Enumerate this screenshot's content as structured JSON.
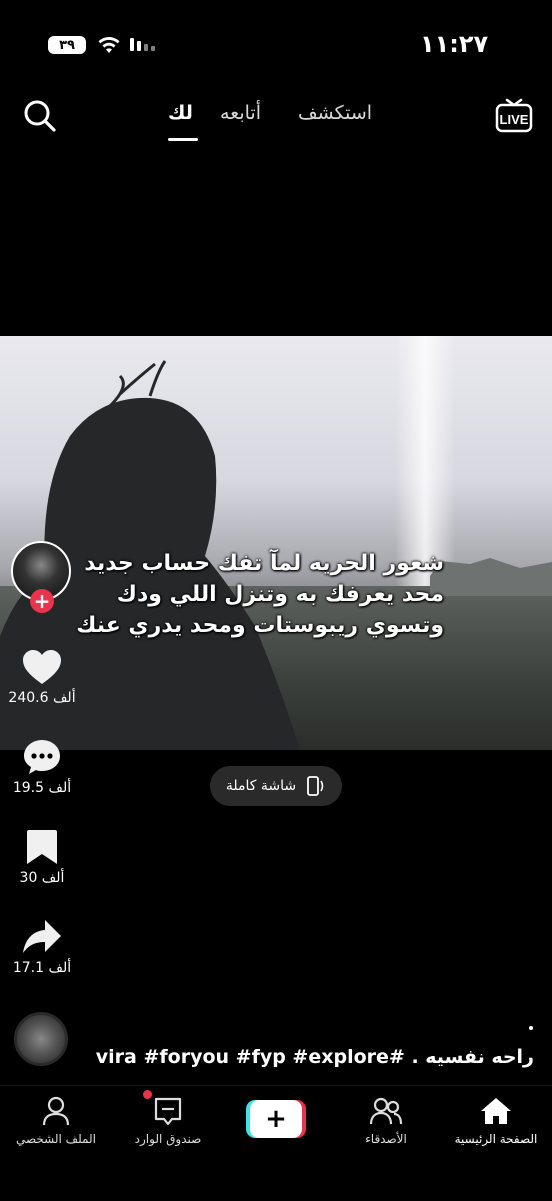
{
  "status_bar": {
    "time": "١١:٢٧",
    "battery": "٣٩"
  },
  "top_nav": {
    "tabs": [
      {
        "label": "استكشف",
        "active": false
      },
      {
        "label": "أتابعه",
        "active": false
      },
      {
        "label": "لك",
        "active": true
      }
    ],
    "icons": {
      "search": "search-icon",
      "live": "live-icon"
    },
    "live_label": "LIVE"
  },
  "video": {
    "caption_lines": [
      "شعور الحريه لمآ تفك حساب جديد",
      "محد يعرفك به وتنزل اللي ودك",
      "وتسوي ريبوستات ومحد يدري عنك"
    ],
    "fullscreen_label": "شاشة كاملة"
  },
  "actions": {
    "follow_symbol": "+",
    "likes": "240.6 ألف",
    "comments": "19.5 ألف",
    "favorites": "30 ألف",
    "shares": "17.1 ألف"
  },
  "description": {
    "text": "راحه نفسيه . #vira #foryou #fyp  #explore"
  },
  "bottom_nav": {
    "items": [
      {
        "label": "الصفحة الرئيسية",
        "icon": "home-icon",
        "active": true
      },
      {
        "label": "الأصدقاء",
        "icon": "friends-icon",
        "active": false
      },
      {
        "label": "",
        "icon": "create-icon",
        "active": false
      },
      {
        "label": "صندوق الوارد",
        "icon": "inbox-icon",
        "active": false
      },
      {
        "label": "الملف الشخصي",
        "icon": "profile-icon",
        "active": false
      }
    ],
    "create_symbol": "+"
  },
  "colors": {
    "accent": "#e8344c",
    "background": "#000000",
    "text": "#ffffff"
  }
}
